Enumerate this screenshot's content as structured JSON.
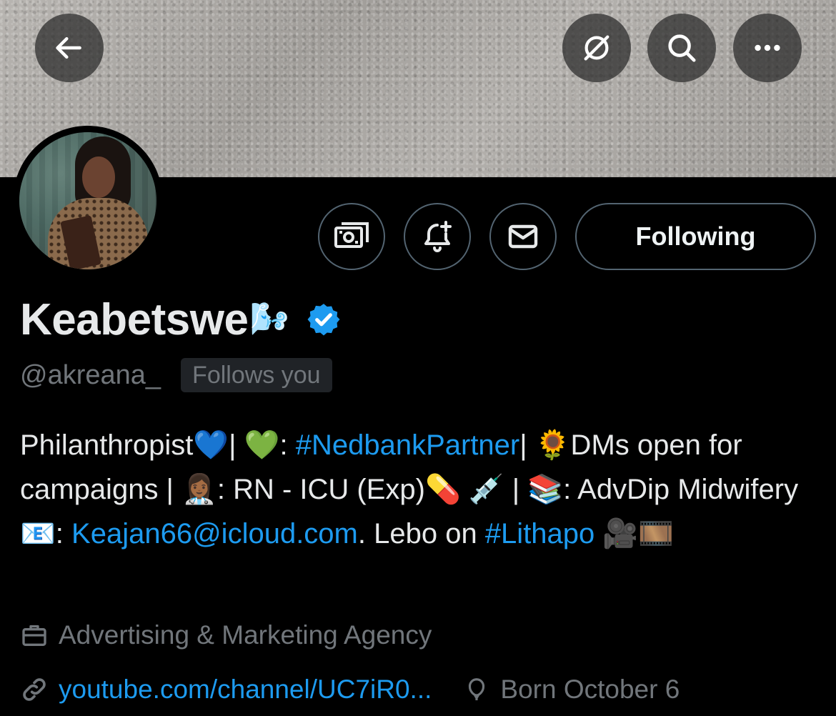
{
  "header": {
    "back_icon": "arrow-left-icon",
    "grok_icon": "slashed-circle-icon",
    "search_icon": "search-icon",
    "more_icon": "more-horizontal-icon"
  },
  "actions": {
    "tip_icon": "money-icon",
    "notify_icon": "bell-plus-icon",
    "message_icon": "mail-icon",
    "following_label": "Following"
  },
  "profile": {
    "display_name": "Keabetswe",
    "name_emoji": "🌬️",
    "verified": true,
    "handle": "@akreana_",
    "follows_you_label": "Follows you",
    "bio": {
      "t1": "Philanthropist💙| 💚: ",
      "hashtag1": "#NedbankPartner",
      "t2": "| 🌻DMs open for campaigns | 👩🏾‍⚕️: RN - ICU (Exp)💊 💉 | 📚: AdvDip Midwifery 📧: ",
      "email": "Keajan66@icloud.com",
      "t3": ". Lebo on ",
      "hashtag2": "#Lithapo",
      "t4": " 🎥🎞️"
    },
    "category": "Advertising & Marketing Agency",
    "website": "youtube.com/channel/UC7iR0...",
    "birthday": "Born October 6"
  },
  "colors": {
    "accent": "#1d9bf0",
    "muted": "#71767b",
    "background": "#000000",
    "text": "#e7e9ea",
    "border": "#536471"
  }
}
